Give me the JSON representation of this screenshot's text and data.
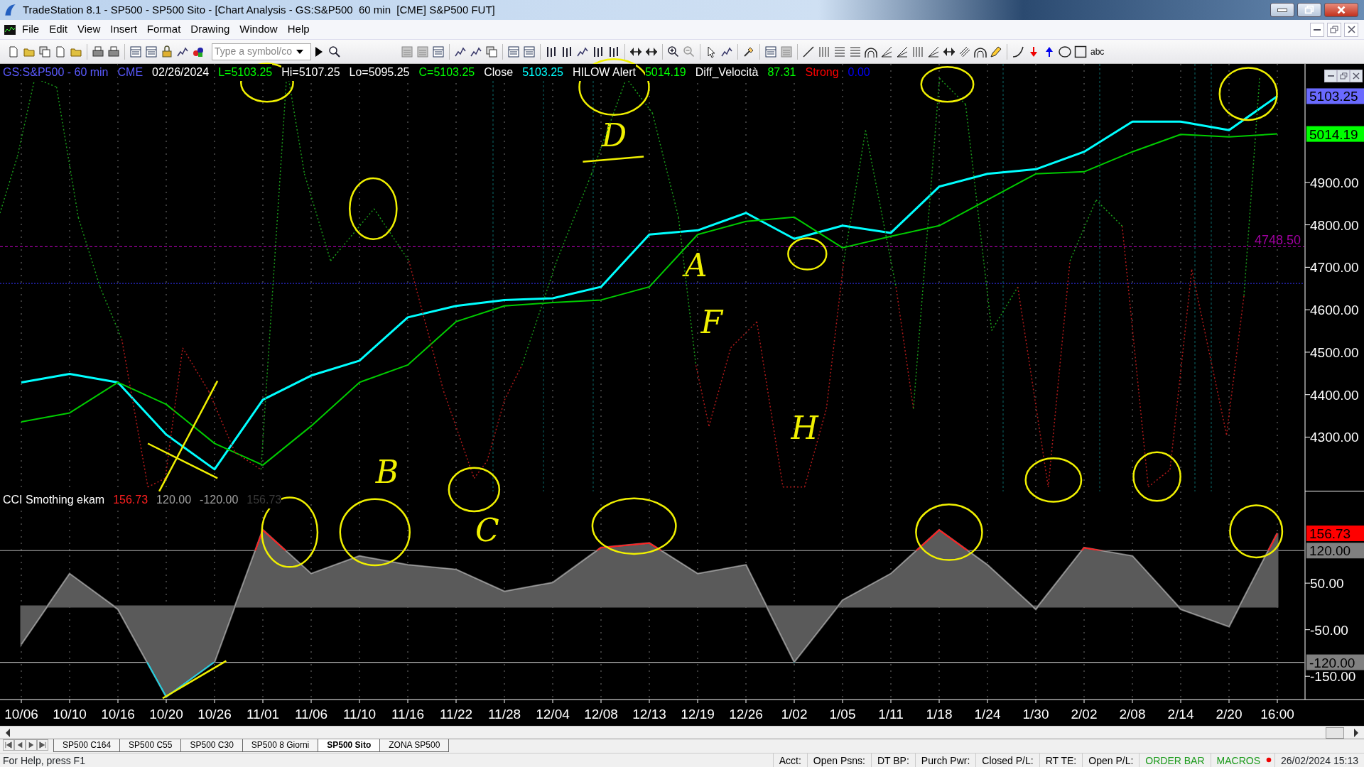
{
  "window": {
    "title": "TradeStation 8.1 - SP500 - SP500 Sito - [Chart Analysis - GS:S&P500  60 min  [CME] S&P500 FUT]"
  },
  "menu": [
    "File",
    "Edit",
    "View",
    "Insert",
    "Format",
    "Drawing",
    "Window",
    "Help"
  ],
  "toolbar": {
    "symbol_field": {
      "placeholder": "Type a symbol/co"
    },
    "text_tool": "abc"
  },
  "price_panel": {
    "legend": [
      {
        "text": "GS:S&P500 - 60 min",
        "color": "#5a5aff"
      },
      {
        "text": "CME",
        "color": "#5a5aff"
      },
      {
        "text": "02/26/2024",
        "color": "#ffffff"
      },
      {
        "text": "L=5103.25",
        "color": "#00ff00"
      },
      {
        "text": "Hi=5107.25",
        "color": "#ffffff"
      },
      {
        "text": "Lo=5095.25",
        "color": "#ffffff"
      },
      {
        "text": "C=5103.25",
        "color": "#00ff00"
      },
      {
        "text": "Close",
        "color": "#ffffff"
      },
      {
        "text": "5103.25",
        "color": "#00ffff"
      },
      {
        "text": "HILOW Alert",
        "color": "#ffffff"
      },
      {
        "text": "5014.19",
        "color": "#00ff00"
      },
      {
        "text": "Diff_Velocità",
        "color": "#ffffff"
      },
      {
        "text": "87.31",
        "color": "#00ff00"
      },
      {
        "text": "Strong",
        "color": "#ff0000"
      },
      {
        "text": "0.00",
        "color": "#0000ff"
      }
    ],
    "axis_markers": [
      {
        "label": "5103.25",
        "color": "#6a6aff"
      },
      {
        "label": "5014.19",
        "color": "#00ff00"
      }
    ],
    "chart_data": {
      "type": "line",
      "ylim": [
        4172,
        5179
      ],
      "yticks": [
        {
          "value": 4300,
          "label": "4300.00"
        },
        {
          "value": 4400,
          "label": "4400.00"
        },
        {
          "value": 4500,
          "label": "4500.00"
        },
        {
          "value": 4600,
          "label": "4600.00"
        },
        {
          "value": 4700,
          "label": "4700.00"
        },
        {
          "value": 4800,
          "label": "4800.00"
        },
        {
          "value": 4900,
          "label": "4900.00"
        }
      ],
      "series": [
        {
          "color": "#00ffff",
          "values": [
            4429,
            4449,
            4429,
            4306,
            4224,
            4388,
            4445,
            4480,
            4582,
            4609,
            4623,
            4627,
            4654,
            4777,
            4787,
            4828,
            4767,
            4798,
            4781,
            4890,
            4920,
            4931,
            4972,
            5043,
            5043,
            5023,
            5103
          ]
        },
        {
          "color": "#00cc00",
          "values": [
            4336,
            4357,
            4429,
            4377,
            4285,
            4234,
            4326,
            4429,
            4470,
            4572,
            4609,
            4617,
            4623,
            4654,
            4777,
            4808,
            4818,
            4746,
            4773,
            4798,
            4859,
            4920,
            4925,
            4972,
            5013,
            5007,
            5014
          ]
        }
      ],
      "grid": true,
      "ref_lines": [
        {
          "axis": "y",
          "value": 4748.5,
          "label": "4748.50",
          "color": "#a000a0"
        },
        {
          "axis": "y",
          "value": 4662,
          "color": "#2a2ad0"
        }
      ],
      "annotations": [
        {
          "text": "D"
        },
        {
          "text": "A"
        },
        {
          "text": "F"
        },
        {
          "text": "H"
        },
        {
          "text": "B"
        }
      ]
    }
  },
  "cci_panel": {
    "legend": [
      {
        "text": "CCI Smothing ekam",
        "color": "#ffffff"
      },
      {
        "text": "156.73",
        "color": "#ff2020"
      },
      {
        "text": "120.00",
        "color": "#a0a0a0"
      },
      {
        "text": "-120.00",
        "color": "#a0a0a0"
      },
      {
        "text": "156.73",
        "color": "#3a3a3a"
      }
    ],
    "axis_markers": [
      {
        "label": "156.73",
        "color": "#ff0000"
      }
    ],
    "chart_data": {
      "type": "area",
      "categories": [
        "10/06",
        "10/10",
        "10/16",
        "10/20",
        "10/26",
        "11/01",
        "11/06",
        "11/10",
        "11/16",
        "11/22",
        "11/28",
        "12/04",
        "12/08",
        "12/13",
        "12/19",
        "12/26",
        "1/02",
        "1/05",
        "1/11",
        "1/18",
        "1/24",
        "1/30",
        "2/02",
        "2/08",
        "2/14",
        "2/20",
        "16:00"
      ],
      "ylim": [
        -200,
        247
      ],
      "yticks": [
        {
          "value": 50,
          "label": "50.00"
        },
        {
          "value": -50,
          "label": "-50.00"
        },
        {
          "value": -150,
          "label": "-150.00"
        }
      ],
      "series": [
        {
          "color": "#5a5a5a",
          "values": [
            -81,
            70,
            -6,
            -194,
            -119,
            164,
            70,
            108,
            89,
            79,
            32,
            51,
            126,
            136,
            70,
            89,
            -119,
            13,
            70,
            164,
            89,
            -6,
            126,
            108,
            -6,
            -43,
            157
          ]
        }
      ],
      "grid": true,
      "ref_lines": [
        {
          "axis": "y",
          "value": 120,
          "label": "120.00",
          "color": "#b0b0b0"
        },
        {
          "axis": "y",
          "value": -120,
          "label": "-120.00",
          "color": "#b0b0b0"
        }
      ],
      "annotations": [
        {
          "text": "C"
        }
      ]
    }
  },
  "sheet_tabs": [
    {
      "label": "SP500 C164",
      "selected": false
    },
    {
      "label": "SP500 C55",
      "selected": false
    },
    {
      "label": "SP500 C30",
      "selected": false
    },
    {
      "label": "SP500 8 Giorni",
      "selected": false
    },
    {
      "label": "SP500 Sito",
      "selected": true
    },
    {
      "label": "ZONA SP500",
      "selected": false
    }
  ],
  "status_bar": {
    "help": "For Help, press F1",
    "fields": [
      {
        "text": "Acct:",
        "color": "#000000"
      },
      {
        "text": "Open Psns:",
        "color": "#000000"
      },
      {
        "text": "DT BP:",
        "color": "#000000"
      },
      {
        "text": "Purch Pwr:",
        "color": "#000000"
      },
      {
        "text": "Closed P/L:",
        "color": "#000000"
      },
      {
        "text": "RT TE:",
        "color": "#000000"
      },
      {
        "text": "Open P/L:",
        "color": "#000000"
      },
      {
        "text": "ORDER BAR",
        "color": "#1a9a1a"
      },
      {
        "text": "MACROS",
        "color": "#1a9a1a"
      }
    ],
    "datetime": "26/02/2024 15:13"
  }
}
